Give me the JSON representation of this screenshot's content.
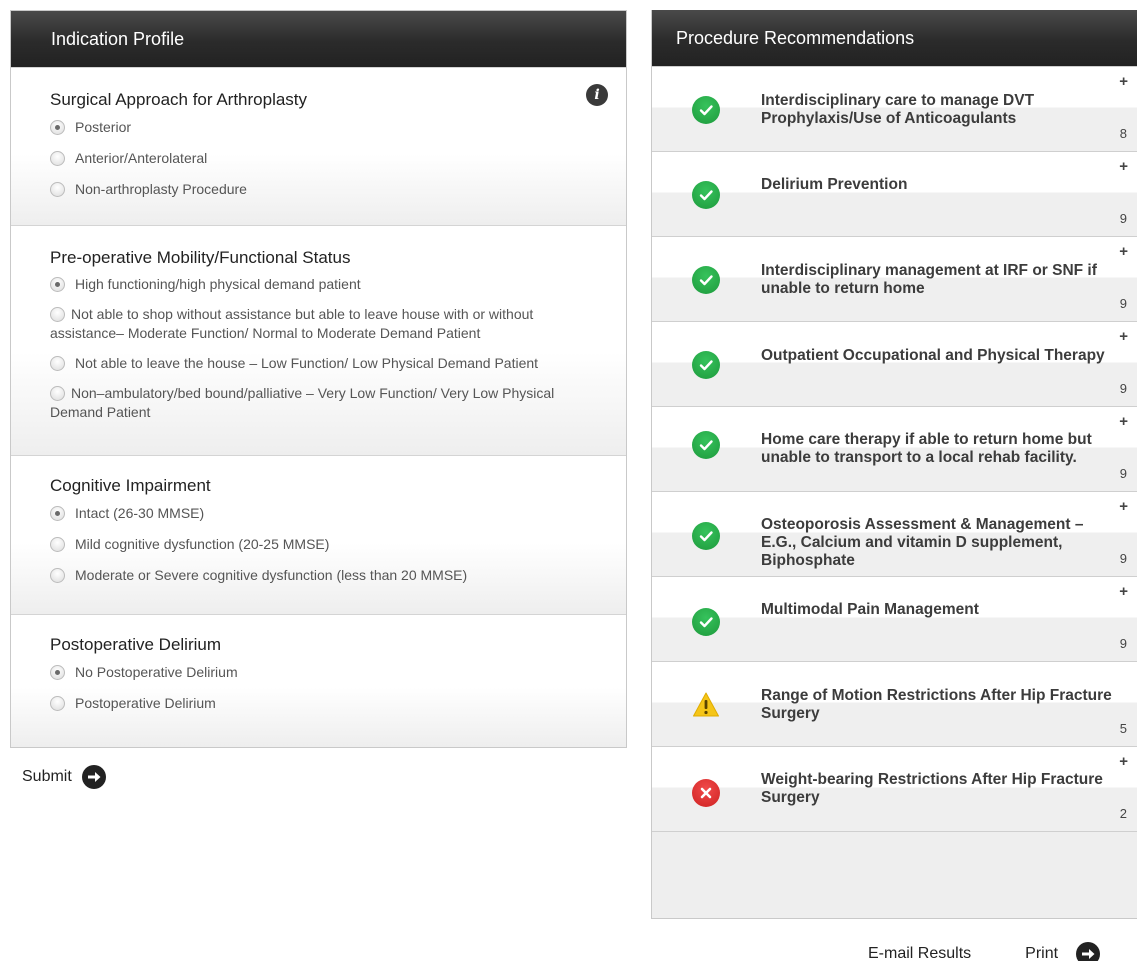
{
  "indication_panel": {
    "title": "Indication Profile",
    "info_icon": "info-icon",
    "sections": [
      {
        "title": "Surgical Approach for Arthroplasty",
        "options": [
          {
            "label": "Posterior",
            "checked": true
          },
          {
            "label": "Anterior/Anterolateral",
            "checked": false
          },
          {
            "label": "Non-arthroplasty Procedure",
            "checked": false
          }
        ]
      },
      {
        "title": "Pre-operative Mobility/Functional Status",
        "options": [
          {
            "label": "High functioning/high physical demand patient",
            "checked": true
          },
          {
            "label": "Not able to shop without assistance but able to leave house with or without assistance– Moderate Function/ Normal to Moderate Demand Patient",
            "checked": false
          },
          {
            "label": "Not able to leave the house – Low Function/ Low Physical Demand Patient",
            "checked": false
          },
          {
            "label": "Non–ambulatory/bed bound/palliative – Very Low Function/ Very Low Physical Demand Patient",
            "checked": false
          }
        ]
      },
      {
        "title": "Cognitive Impairment",
        "options": [
          {
            "label": "Intact (26-30 MMSE)",
            "checked": true
          },
          {
            "label": "Mild cognitive dysfunction (20-25 MMSE)",
            "checked": false
          },
          {
            "label": "Moderate or Severe cognitive dysfunction (less than 20 MMSE)",
            "checked": false
          }
        ]
      },
      {
        "title": "Postoperative Delirium",
        "options": [
          {
            "label": "No Postoperative Delirium",
            "checked": true
          },
          {
            "label": "Postoperative Delirium",
            "checked": false
          }
        ]
      }
    ],
    "submit_label": "Submit"
  },
  "recommendations_panel": {
    "title": "Procedure Recommendations",
    "items": [
      {
        "title": "Interdisciplinary care to manage DVT Prophylaxis/Use of Anticoagulants",
        "score": "8",
        "status": "appropriate",
        "icon": "check-icon",
        "expand": "+"
      },
      {
        "title": "Delirium Prevention",
        "score": "9",
        "status": "appropriate",
        "icon": "check-icon",
        "expand": "+"
      },
      {
        "title": "Interdisciplinary management at IRF or SNF if unable to return home",
        "score": "9",
        "status": "appropriate",
        "icon": "check-icon",
        "expand": "+"
      },
      {
        "title": "Outpatient Occupational and Physical Therapy",
        "score": "9",
        "status": "appropriate",
        "icon": "check-icon",
        "expand": "+"
      },
      {
        "title": "Home care therapy if able to return home but unable to transport to a local rehab facility.",
        "score": "9",
        "status": "appropriate",
        "icon": "check-icon",
        "expand": "+"
      },
      {
        "title": "Osteoporosis Assessment & Management – E.G., Calcium and vitamin D supplement, Biphosphate",
        "score": "9",
        "status": "appropriate",
        "icon": "check-icon",
        "expand": "+"
      },
      {
        "title": "Multimodal Pain Management",
        "score": "9",
        "status": "appropriate",
        "icon": "check-icon",
        "expand": "+"
      },
      {
        "title": "Range of Motion Restrictions After Hip Fracture Surgery",
        "score": "5",
        "status": "maybe",
        "icon": "warning-icon",
        "expand": ""
      },
      {
        "title": "Weight-bearing Restrictions After Hip Fracture Surgery",
        "score": "2",
        "status": "rarely",
        "icon": "x-icon",
        "expand": "+"
      }
    ]
  },
  "footer": {
    "email_label": "E-mail Results",
    "print_label": "Print"
  },
  "colors": {
    "header_bg": "#2b2b2b",
    "ok": "#22a140",
    "warn": "#f5c518",
    "bad": "#dd2a2a"
  }
}
